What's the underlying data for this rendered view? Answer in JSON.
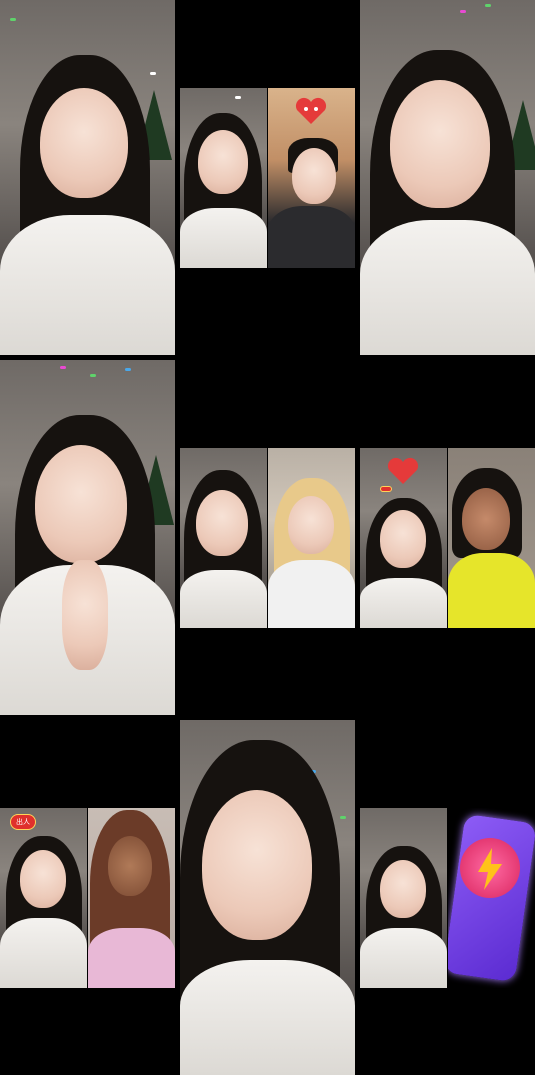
{
  "badges": {
    "battle_badge_1": "",
    "battle_badge_2": "出人"
  },
  "colors": {
    "background": "#000000",
    "badge_red": "#e0302c",
    "card_purple": "#7a45e6"
  },
  "icons": [
    "heart-crown-icon",
    "lightning-icon"
  ]
}
